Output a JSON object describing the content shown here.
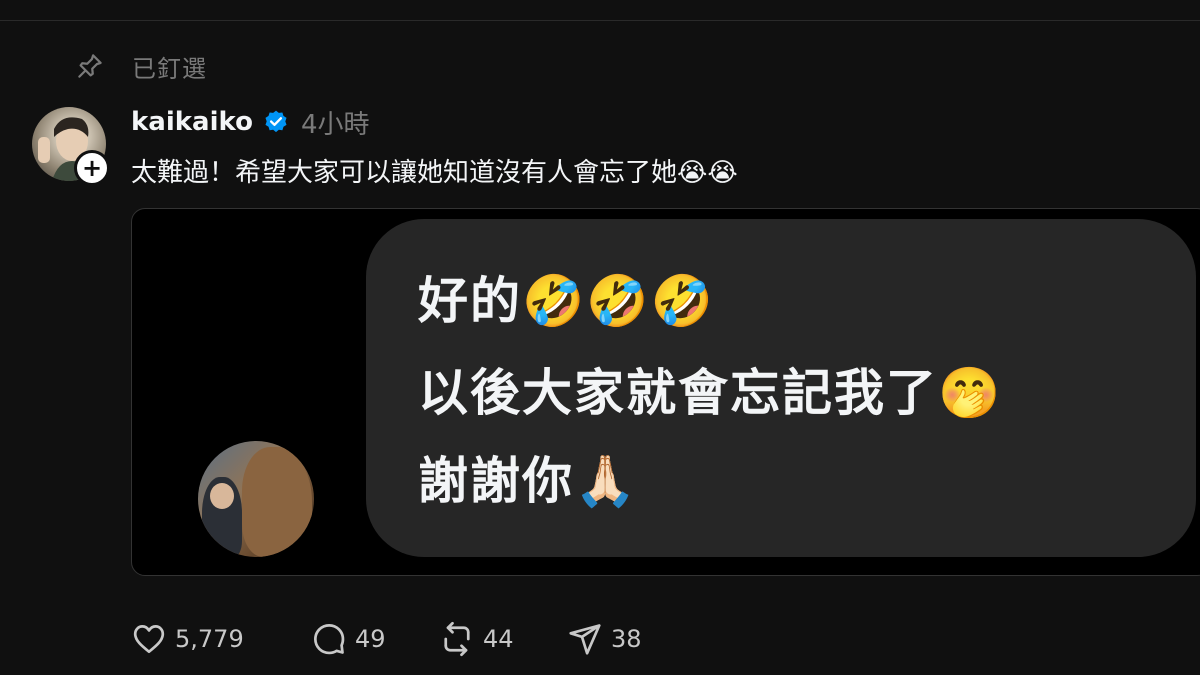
{
  "pinned": {
    "label": "已釘選",
    "icon": "pin-icon"
  },
  "post": {
    "username": "kaikaiko",
    "verified": true,
    "timestamp": "4小時",
    "text": "太難過！希望大家可以讓她知道沒有人會忘了她😭😭",
    "media": {
      "message_lines": [
        "好的🤣🤣🤣",
        "以後大家就會忘記我了🤭",
        "謝謝你🙏🏻"
      ]
    }
  },
  "actions": {
    "likes": "5,779",
    "replies": "49",
    "reposts": "44",
    "shares": "38"
  },
  "colors": {
    "background": "#101010",
    "text_primary": "#f3f5f7",
    "text_secondary": "#7a7a7a",
    "verified_blue": "#0095f6",
    "bubble": "#262626"
  }
}
